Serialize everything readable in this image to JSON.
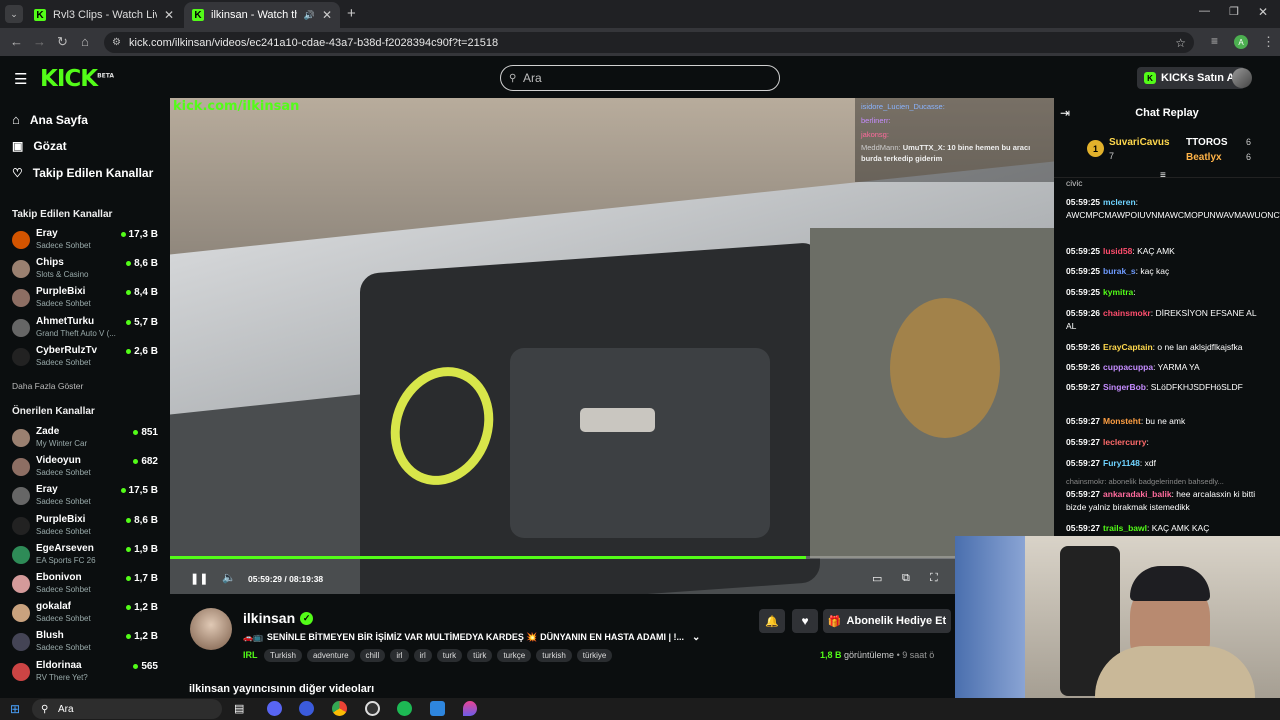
{
  "browser": {
    "tabs": [
      {
        "title": "Rvl3 Clips - Watch Live on Kick"
      },
      {
        "title": "ilkinsan - Watch the VOD on Kick"
      }
    ],
    "url": "kick.com/ilkinsan/videos/ec241a10-cdae-43a7-b38d-f2028394c90f?t=21518"
  },
  "header": {
    "logo": "KICK",
    "logo_badge": "BETA",
    "search_placeholder": "Ara",
    "buy_kicks": "KICKs Satın Al"
  },
  "sidebar": {
    "nav": [
      {
        "label": "Ana Sayfa",
        "icon": "home-icon"
      },
      {
        "label": "Gözat",
        "icon": "browse-icon"
      },
      {
        "label": "Takip Edilen Kanallar",
        "icon": "heart-icon"
      }
    ],
    "followed_header": "Takip Edilen Kanallar",
    "followed": [
      {
        "name": "Eray",
        "category": "Sadece Sohbet",
        "viewers": "17,3 B"
      },
      {
        "name": "Chips",
        "category": "Slots & Casino",
        "viewers": "8,6 B"
      },
      {
        "name": "PurpleBixi",
        "category": "Sadece Sohbet",
        "viewers": "8,4 B"
      },
      {
        "name": "AhmetTurku",
        "category": "Grand Theft Auto V (...",
        "viewers": "5,7 B"
      },
      {
        "name": "CyberRulzTv",
        "category": "Sadece Sohbet",
        "viewers": "2,6 B"
      }
    ],
    "show_more": "Daha Fazla Göster",
    "recommended_header": "Önerilen Kanallar",
    "recommended": [
      {
        "name": "Zade",
        "category": "My Winter Car",
        "viewers": "851"
      },
      {
        "name": "Videoyun",
        "category": "Sadece Sohbet",
        "viewers": "682"
      },
      {
        "name": "Eray",
        "category": "Sadece Sohbet",
        "viewers": "17,5 B"
      },
      {
        "name": "PurpleBixi",
        "category": "Sadece Sohbet",
        "viewers": "8,6 B"
      },
      {
        "name": "EgeArseven",
        "category": "EA Sports FC 26",
        "viewers": "1,9 B"
      },
      {
        "name": "Ebonivon",
        "category": "Sadece Sohbet",
        "viewers": "1,7 B"
      },
      {
        "name": "gokalaf",
        "category": "Sadece Sohbet",
        "viewers": "1,2 B"
      },
      {
        "name": "Blush",
        "category": "Sadece Sohbet",
        "viewers": "1,2 B"
      },
      {
        "name": "Eldorinaa",
        "category": "RV There Yet?",
        "viewers": "565"
      }
    ]
  },
  "video": {
    "overlay_text": "kick.com/ilkinsan",
    "time_current": "05:59:29",
    "time_total": "08:19:38",
    "progress": 0.72,
    "overlay_chat": [
      {
        "user": "isidore_Lucien_Ducasse:",
        "text": ""
      },
      {
        "user": "berlinerr:",
        "text": ""
      },
      {
        "user": "jakonsg:",
        "text": ""
      },
      {
        "user": "MeddMann:",
        "text": "UmuTTX_X: 10 bine hemen bu aracı burda terkedip giderim"
      }
    ]
  },
  "stream": {
    "channel": "ilkinsan",
    "title": "SENİNLE BİTMEYEN BİR İŞİMİZ VAR MULTİMEDYA KARDEŞ 💥 DÜNYANIN EN HASTA ADAMI | !...",
    "category": "IRL",
    "tags": [
      "Turkish",
      "adventure",
      "chill",
      "irl",
      "irl",
      "turk",
      "türk",
      "turkçe",
      "turkish",
      "türkiye"
    ],
    "views_count": "1,8 B",
    "views_label": "görüntüleme",
    "age": "• 9 saat ö",
    "gift_button": "Abonelik Hediye Et",
    "more_videos": "ilkinsan yayıncısının diğer videoları"
  },
  "chat": {
    "title": "Chat Replay",
    "leaderboard": [
      {
        "rank": "1",
        "name": "SuvariCavus",
        "count": "7"
      },
      {
        "name": "TTOROS",
        "count": "6"
      },
      {
        "name": "Beatlyx",
        "count": "6"
      }
    ],
    "partial_line": "civic",
    "messages": [
      {
        "time": "05:59:25",
        "user": "mcleren",
        "color": "#6fd3ff",
        "text": "AWCMPCMAWPOIUVNMAWCMOPUNWAVMAWUONCWA"
      },
      {
        "time": "05:59:25",
        "user": "lusid58",
        "color": "#ff4d6d",
        "text": "KAÇ AMK"
      },
      {
        "time": "05:59:25",
        "user": "burak_s",
        "color": "#6f9bff",
        "text": "kaç kaç"
      },
      {
        "time": "05:59:25",
        "user": "kymitra",
        "color": "#53fc18",
        "text": ""
      },
      {
        "time": "05:59:26",
        "user": "chainsmokr",
        "color": "#ff4d6d",
        "text": "DİREKSİYON EFSANE AL AL"
      },
      {
        "time": "05:59:26",
        "user": "ErayCaptain",
        "color": "#ffd84d",
        "text": "o ne lan aklsjdflkajsfka"
      },
      {
        "time": "05:59:26",
        "user": "cuppacuppa",
        "color": "#c58cff",
        "text": "YARMA YA"
      },
      {
        "time": "05:59:27",
        "user": "SingerBob",
        "color": "#c58cff",
        "text": "SLöDFKHJSDFHöSLDF"
      },
      {
        "time": "05:59:27",
        "user": "Monsteht",
        "color": "#ff9f43",
        "text": "bu ne amk"
      },
      {
        "time": "05:59:27",
        "user": "leclercurry",
        "color": "#ff6b6b",
        "text": ""
      },
      {
        "time": "05:59:27",
        "user": "Fury1148",
        "color": "#6fd3ff",
        "text": "xdf"
      },
      {
        "time": "05:59:27",
        "user": "ankaradaki_balik",
        "color": "#ff6b9d",
        "text": "hee arcalasxin ki bitti bizde yalniz birakmak istemedikk",
        "reply": "chainsmokr: abonelik badgelerinden bahsedly..."
      },
      {
        "time": "05:59:27",
        "user": "trails_bawl",
        "color": "#53fc18",
        "text": "KAÇ AMK KAÇ"
      }
    ]
  },
  "taskbar": {
    "search_placeholder": "Ara"
  }
}
